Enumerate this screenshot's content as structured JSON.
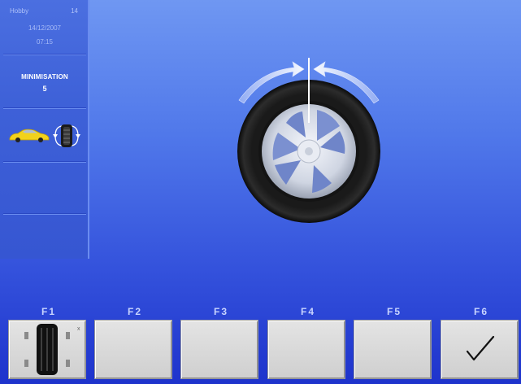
{
  "sidebar": {
    "user_line_left": "Hobby",
    "user_line_right": "14",
    "date": "14/12/2007",
    "time": "07:15",
    "mode_title": "MINIMISATION",
    "mode_value": "5",
    "icons": [
      "car-icon",
      "wheel-balance-icon"
    ]
  },
  "main": {
    "graphic": "wheel-with-rotation-arrows-icon"
  },
  "function_keys": [
    {
      "label": "F1",
      "icon": "tire-tread-icon"
    },
    {
      "label": "F2",
      "icon": ""
    },
    {
      "label": "F3",
      "icon": ""
    },
    {
      "label": "F4",
      "icon": ""
    },
    {
      "label": "F5",
      "icon": ""
    },
    {
      "label": "F6",
      "icon": "checkmark-icon"
    }
  ],
  "colors": {
    "background_top": "#6f97f2",
    "background_bottom": "#1e33cc",
    "key_face": "#dadada",
    "car": "#f2d21b"
  }
}
